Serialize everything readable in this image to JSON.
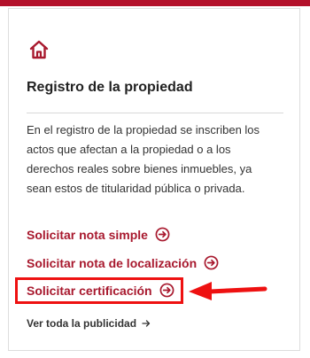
{
  "card": {
    "title": "Registro de la propiedad",
    "description": "En el registro de la propiedad se inscriben los actos que afectan a la propiedad o a los derechos reales sobre bienes inmuebles, ya sean estos de titularidad pública o privada.",
    "icon": "home-icon"
  },
  "links": {
    "nota_simple": "Solicitar nota simple",
    "nota_localizacion": "Solicitar nota de localización",
    "certificacion": "Solicitar certificación"
  },
  "footer_link": "Ver toda la publicidad",
  "colors": {
    "brand_red": "#a8192e",
    "top_bar": "#b3102a",
    "annotation_red": "#ee1111",
    "text_dark": "#222222"
  }
}
